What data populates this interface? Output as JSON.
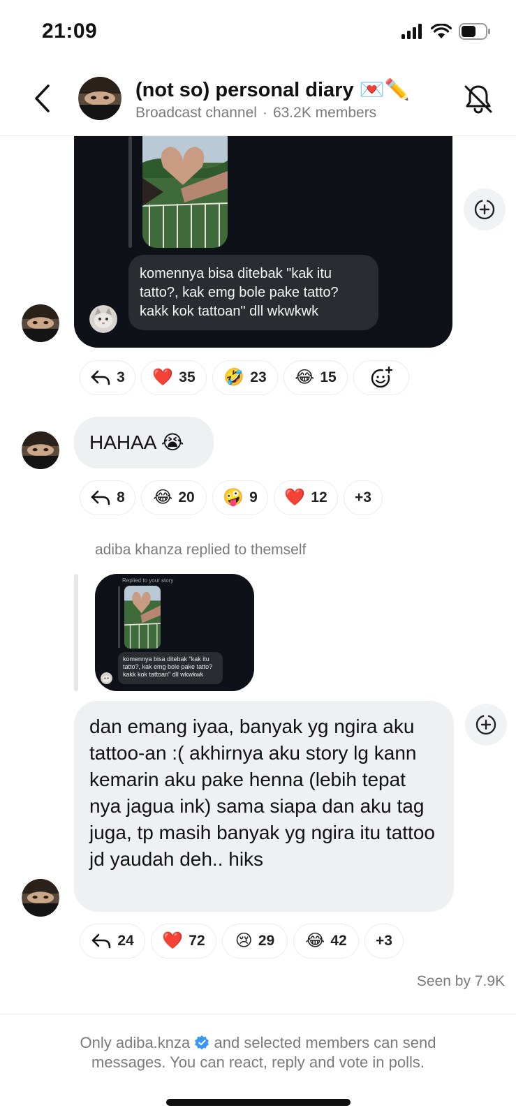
{
  "status_bar": {
    "time": "21:09",
    "icons": [
      "signal-icon",
      "wifi-icon",
      "battery-icon"
    ]
  },
  "header": {
    "back_icon": "chevron-left-icon",
    "title": "(not so) personal diary",
    "title_emojis": "💌✏️",
    "channel_type": "Broadcast channel",
    "separator": "·",
    "members": "63.2K members",
    "mute_icon": "bell-off-icon"
  },
  "messages": {
    "story_reply": {
      "comment": "komennya bisa ditebak \"kak itu tatto?, kak emg bole pake tatto? kakk kok tattoan\" dll wkwkwk"
    },
    "story_reactions": [
      {
        "icon": "reply-icon",
        "count": "3"
      },
      {
        "emoji": "❤️",
        "count": "35"
      },
      {
        "emoji": "🤣",
        "count": "23"
      },
      {
        "emoji": "😂",
        "count": "15"
      }
    ],
    "add_reaction_icon": "add-emoji-icon",
    "hahaa": {
      "text": "HAHAA",
      "emoji": "😭"
    },
    "hahaa_reactions": [
      {
        "icon": "reply-icon",
        "count": "8"
      },
      {
        "emoji": "😂",
        "count": "20"
      },
      {
        "emoji": "🤪",
        "count": "9"
      },
      {
        "emoji": "❤️",
        "count": "12"
      },
      {
        "more": "+3"
      }
    ],
    "replied_label": "adiba khanza replied to themself",
    "mini_card": {
      "label": "Replied to your story",
      "comment": "komennya bisa ditebak \"kak itu tatto?, kak emg bole pake tatto? kakk kok tattoan\" dll wkwkwk"
    },
    "long_message": "dan emang iyaa, banyak yg ngira aku tattoo-an :( akhirnya aku story lg kann kemarin aku pake henna (lebih tepat nya jagua ink) sama siapa dan aku tag juga, tp masih banyak yg ngira itu tattoo jd yaudah deh.. hiks",
    "long_reactions": [
      {
        "icon": "reply-icon",
        "count": "24"
      },
      {
        "emoji": "❤️",
        "count": "72"
      },
      {
        "emoji": "😢",
        "count": "29"
      },
      {
        "emoji": "😂",
        "count": "42"
      },
      {
        "more": "+3"
      }
    ],
    "seen": "Seen by 7.9K"
  },
  "footer": {
    "prefix": "Only adiba.knza",
    "suffix": "and selected members can send",
    "line2": "messages. You can react, reply and vote in polls.",
    "verified_icon": "verified-badge-icon"
  },
  "colors": {
    "dark_bubble": "#0e1117",
    "light_bubble": "#eff0f2",
    "verified_blue": "#3897f0",
    "heart_red": "#e0245e",
    "muted_text": "#7a7a7a"
  }
}
